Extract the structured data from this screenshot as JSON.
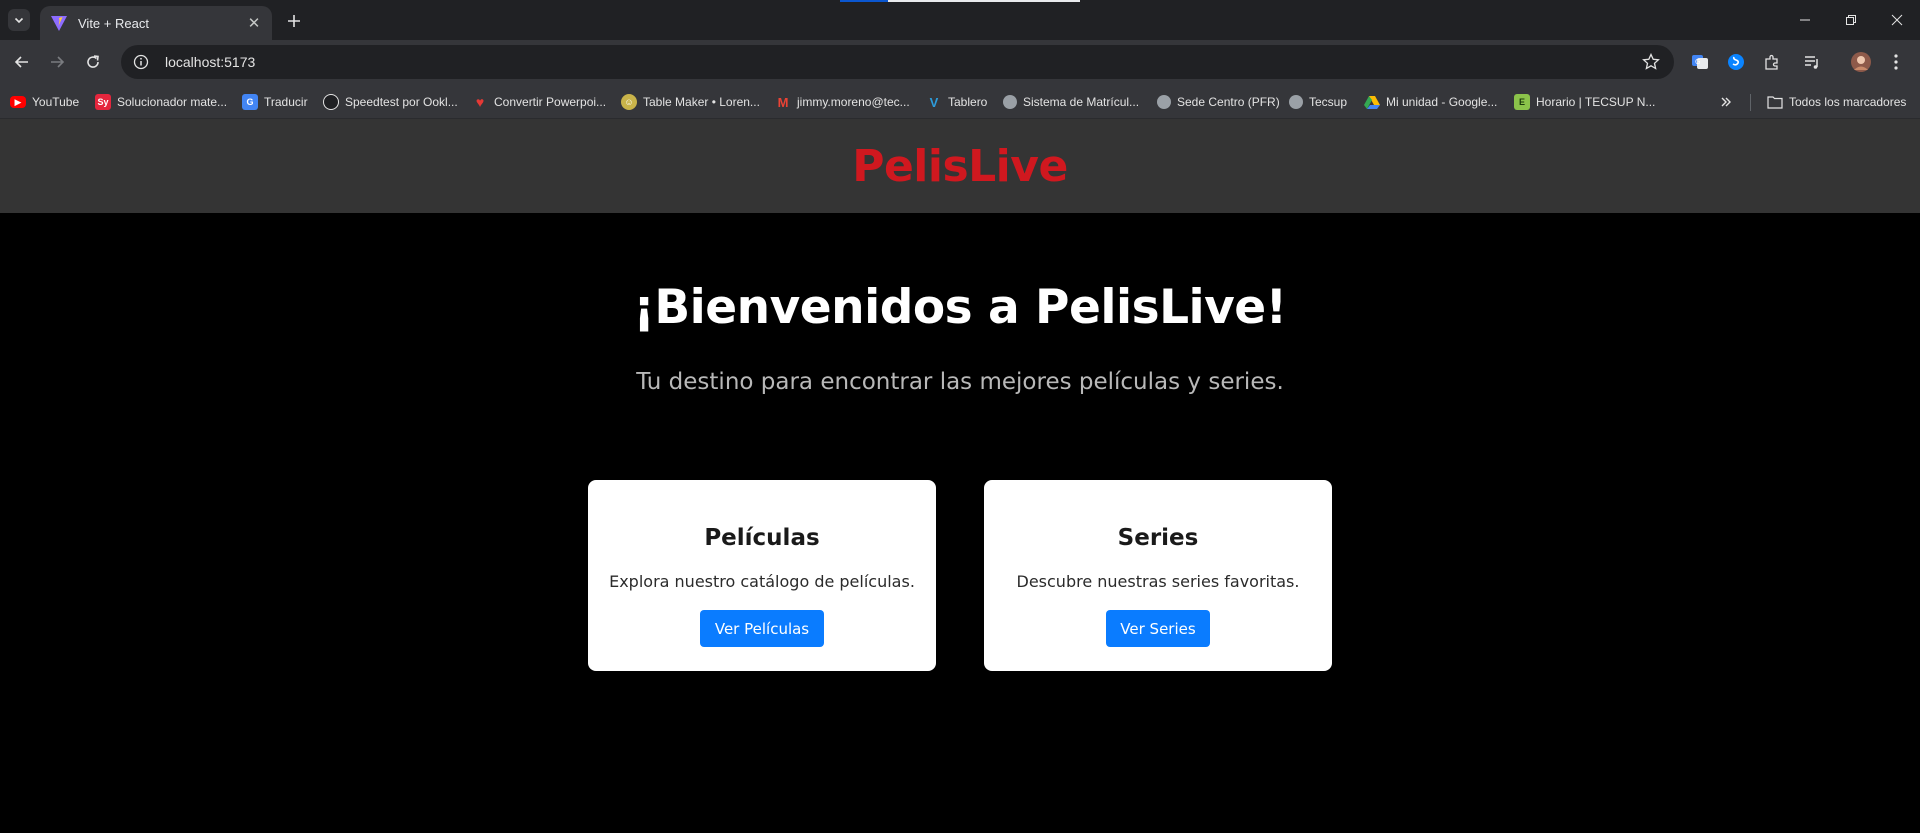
{
  "browser": {
    "tab_title": "Vite + React",
    "url": "localhost:5173",
    "bookmarks": [
      {
        "label": "YouTube",
        "icon": "youtube-icon",
        "color": "#ff0000"
      },
      {
        "label": "Solucionador mate...",
        "icon": "solucionador-icon",
        "color": "#e5263d"
      },
      {
        "label": "Traducir",
        "icon": "translate-icon",
        "color": "#4285f4"
      },
      {
        "label": "Speedtest por Ookl...",
        "icon": "speedtest-icon",
        "color": "#1f2023"
      },
      {
        "label": "Convertir Powerpoi...",
        "icon": "heart-icon",
        "color": "#e53935"
      },
      {
        "label": "Table Maker • Loren...",
        "icon": "table-maker-icon",
        "color": "#c9b44a"
      },
      {
        "label": "jimmy.moreno@tec...",
        "icon": "gmail-icon",
        "color": "#ea4335"
      },
      {
        "label": "Tablero",
        "icon": "tablero-icon",
        "color": "#2d9cdb"
      },
      {
        "label": "Sistema de Matrícul...",
        "icon": "globe-icon",
        "color": "#9aa0a6"
      },
      {
        "label": "Sede Centro (PFR)",
        "icon": "globe-icon",
        "color": "#9aa0a6"
      },
      {
        "label": "Tecsup",
        "icon": "globe-icon",
        "color": "#9aa0a6"
      },
      {
        "label": "Mi unidad - Google...",
        "icon": "google-drive-icon",
        "color": "#34a853"
      },
      {
        "label": "Horario | TECSUP N...",
        "icon": "horario-icon",
        "color": "#8bc34a"
      }
    ],
    "all_bookmarks": "Todos los marcadores"
  },
  "header": {
    "brand": "PelisLive",
    "brand_color": "#d0181f"
  },
  "hero": {
    "title": "¡Bienvenidos a PelisLive!",
    "subtitle": "Tu destino para encontrar las mejores películas y series."
  },
  "cards": [
    {
      "title": "Películas",
      "text": "Explora nuestro catálogo de películas.",
      "button": "Ver Películas"
    },
    {
      "title": "Series",
      "text": "Descubre nuestras series favoritas.",
      "button": "Ver Series"
    }
  ],
  "colors": {
    "accent_button": "#0a7cff",
    "header_bg": "#343434",
    "page_bg": "#000000"
  }
}
